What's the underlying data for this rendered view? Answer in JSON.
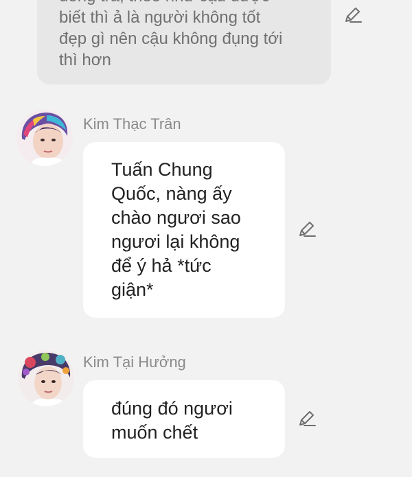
{
  "messages": [
    {
      "lines": [
        "đóng trả, theo như cậu được",
        "biết thì ả là người không tốt",
        "đẹp gì nên cậu không đụng tới",
        "thì hơn"
      ],
      "icon": "pencil-edit-icon"
    },
    {
      "sender": "Kim Thạc Trân",
      "lines": [
        "Tuấn Chung",
        "Quốc, nàng ấy",
        "chào ngươi sao",
        "ngươi lại không",
        "để ý hả *tức",
        "giận*"
      ],
      "avatar_icon": "avatar-portrait",
      "icon": "pencil-edit-icon"
    },
    {
      "sender": "Kim Tại Hưởng",
      "lines": [
        "đúng đó ngươi",
        "muốn chết"
      ],
      "avatar_icon": "avatar-portrait",
      "icon": "pencil-edit-icon"
    }
  ],
  "colors": {
    "background": "#f2f2f2",
    "own_bubble": "#e7e7e7",
    "other_bubble": "#ffffff",
    "sender_name": "#8a8a8a",
    "message_text": "#222222"
  }
}
